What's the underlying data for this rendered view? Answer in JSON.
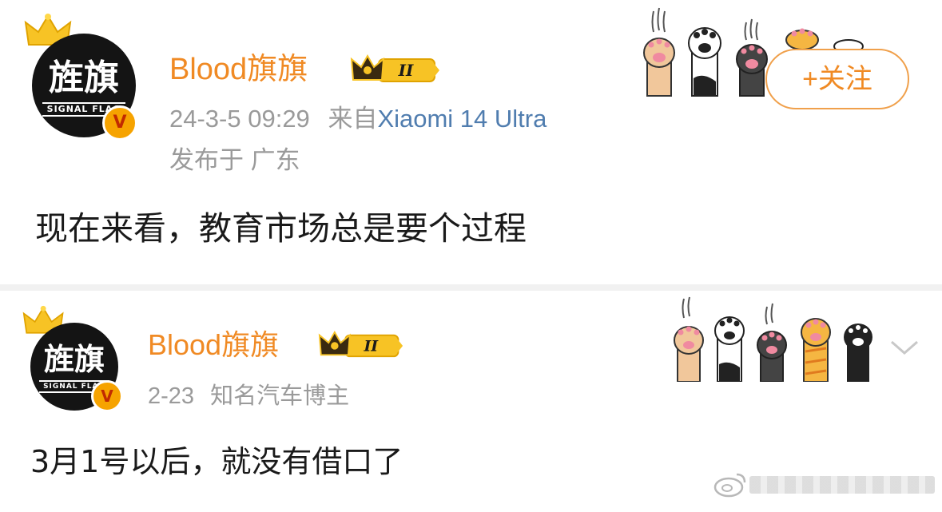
{
  "posts": [
    {
      "user": {
        "name": "Blood旗旗",
        "avatar_text": "旌旗",
        "avatar_sub": "SIGNAL FLAG",
        "level": "II",
        "verified_badge": "V"
      },
      "timestamp": "24-3-5 09:29",
      "source_prefix": "来自",
      "source": "Xiaomi 14 Ultra",
      "location": "发布于 广东",
      "follow_label": "+关注",
      "content": "现在来看，教育市场总是要个过程"
    },
    {
      "user": {
        "name": "Blood旗旗",
        "avatar_text": "旌旗",
        "avatar_sub": "SIGNAL FLAG",
        "level": "II",
        "verified_badge": "V"
      },
      "timestamp": "2-23",
      "tag": "知名汽车博主",
      "content": "3月1号以后，就没有借口了"
    }
  ],
  "icons": {
    "crown": "crown-icon",
    "level": "crown-level-badge-icon",
    "paws": "cat-paws-decoration",
    "chevron": "chevron-down-icon",
    "weibo": "weibo-logo-icon"
  },
  "colors": {
    "username": "#f08a24",
    "source_link": "#507daf",
    "meta": "#9a9a9a",
    "follow_border": "#f0a04b",
    "divider": "#f1f1f1"
  }
}
